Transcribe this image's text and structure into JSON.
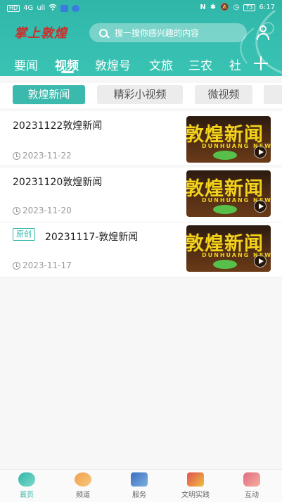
{
  "status_bar": {
    "left": [
      "HD",
      "4G",
      "ull",
      "Wi-Fi"
    ],
    "right_icons": [
      "NFC",
      "bluetooth",
      "mute",
      "alarm"
    ],
    "battery": "73",
    "time": "6:17"
  },
  "header": {
    "logo": "掌上敦煌",
    "search_placeholder": "搜一搜你感兴趣的内容"
  },
  "nav": {
    "tabs": [
      "要闻",
      "视频",
      "敦煌号",
      "文旅",
      "三农",
      "社"
    ],
    "active_index": 1
  },
  "subtabs": {
    "items": [
      "敦煌新闻",
      "精彩小视频",
      "微视频",
      ""
    ],
    "active_index": 0
  },
  "articles": [
    {
      "title": "20231122敦煌新闻",
      "date": "2023-11-22",
      "badge": "",
      "thumb_text": "敦煌新闻",
      "thumb_sub": "DUNHUANG NEWS"
    },
    {
      "title": "20231120敦煌新闻",
      "date": "2023-11-20",
      "badge": "",
      "thumb_text": "敦煌新闻",
      "thumb_sub": "DUNHUANG NEWS"
    },
    {
      "title": "20231117-敦煌新闻",
      "date": "2023-11-17",
      "badge": "原创",
      "thumb_text": "敦煌新闻",
      "thumb_sub": "DUNHUANG NEWS"
    }
  ],
  "bottom_nav": {
    "items": [
      "首页",
      "频道",
      "服务",
      "文明实践",
      "互动"
    ],
    "active_index": 0
  },
  "colors": {
    "brand": "#2fb6a8",
    "logo_red": "#c9302c",
    "thumb_yellow": "#f2d21a"
  }
}
